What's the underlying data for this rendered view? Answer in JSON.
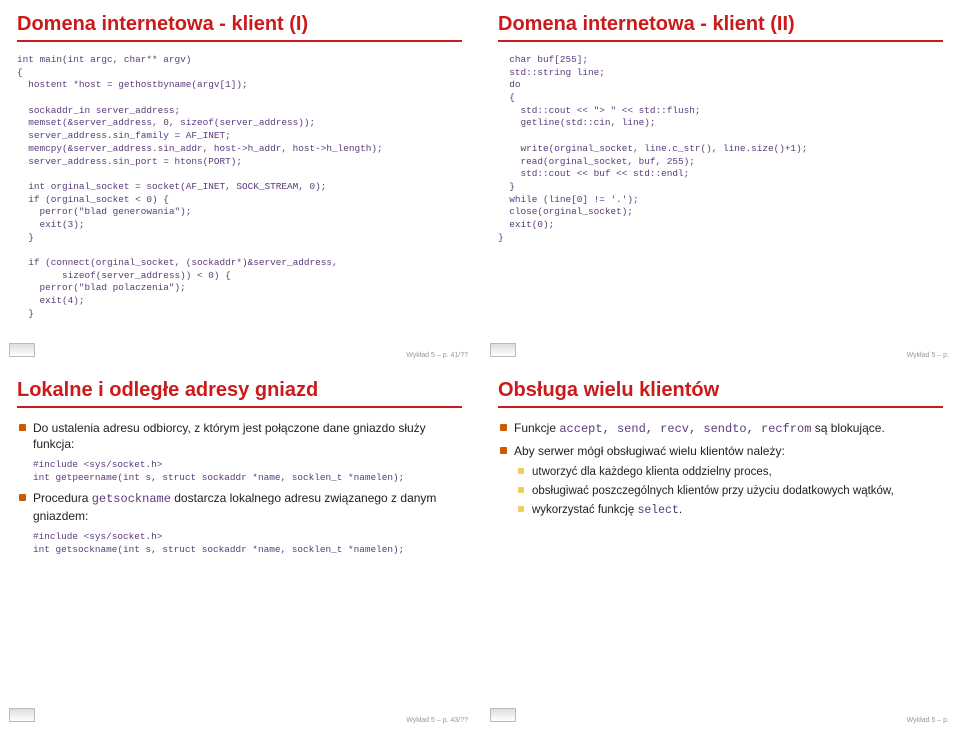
{
  "slides": {
    "s1": {
      "title": "Domena internetowa - klient (I)",
      "code": "int main(int argc, char** argv)\n{\n  hostent *host = gethostbyname(argv[1]);\n\n  sockaddr_in server_address;\n  memset(&server_address, 0, sizeof(server_address));\n  server_address.sin_family = AF_INET;\n  memcpy(&server_address.sin_addr, host->h_addr, host->h_length);\n  server_address.sin_port = htons(PORT);\n\n  int orginal_socket = socket(AF_INET, SOCK_STREAM, 0);\n  if (orginal_socket < 0) {\n    perror(\"blad generowania\");\n    exit(3);\n  }\n\n  if (connect(orginal_socket, (sockaddr*)&server_address,\n        sizeof(server_address)) < 0) {\n    perror(\"blad polaczenia\");\n    exit(4);\n  }",
      "foot": "Wykład 5 – p. 41/??"
    },
    "s2": {
      "title": "Domena internetowa - klient (II)",
      "code": "  char buf[255];\n  std::string line;\n  do\n  {\n    std::cout << \"> \" << std::flush;\n    getline(std::cin, line);\n\n    write(orginal_socket, line.c_str(), line.size()+1);\n    read(orginal_socket, buf, 255);\n    std::cout << buf << std::endl;\n  }\n  while (line[0] != '.');\n  close(orginal_socket);\n  exit(0);\n}",
      "foot": "Wykład 5 – p."
    },
    "s3": {
      "title": "Lokalne i odległe adresy gniazd",
      "b1_a": "Do ustalenia adresu odbiorcy, z którym jest połączone dane gniazdo służy funkcja:",
      "code1": "#include <sys/socket.h>\nint getpeername(int s, struct sockaddr *name, socklen_t *namelen);",
      "b2_a": "Procedura ",
      "b2_b": "getsockname",
      "b2_c": " dostarcza lokalnego adresu związanego z danym gniazdem:",
      "code2": "#include <sys/socket.h>\nint getsockname(int s, struct sockaddr *name, socklen_t *namelen);",
      "foot": "Wykład 5 – p. 43/??"
    },
    "s4": {
      "title": "Obsługa wielu klientów",
      "b1_a": "Funkcje ",
      "b1_b": "accept, send, recv, sendto, recfrom",
      "b1_c": " są blokujące.",
      "b2": "Aby serwer mógł obsługiwać wielu klientów należy:",
      "sub1": "utworzyć dla każdego klienta oddzielny proces,",
      "sub2": "obsługiwać poszczególnych klientów przy użyciu dodatkowych wątków,",
      "sub3_a": "wykorzystać funkcję ",
      "sub3_b": "select",
      "sub3_c": ".",
      "foot": "Wykład 5 – p."
    }
  }
}
